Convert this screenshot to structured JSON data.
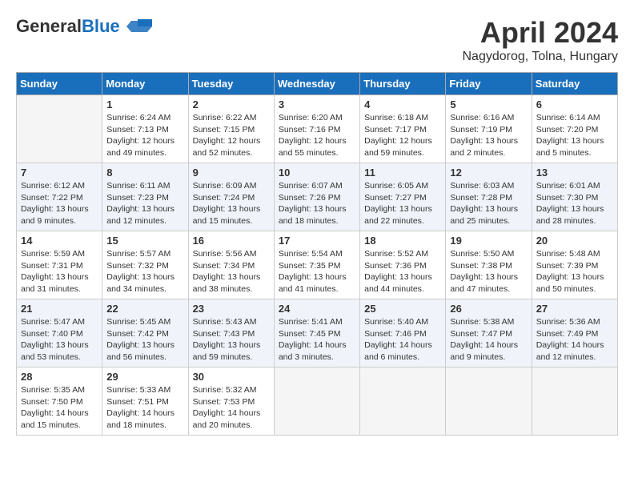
{
  "logo": {
    "line1": "General",
    "line2": "Blue"
  },
  "title": "April 2024",
  "subtitle": "Nagydorog, Tolna, Hungary",
  "weekdays": [
    "Sunday",
    "Monday",
    "Tuesday",
    "Wednesday",
    "Thursday",
    "Friday",
    "Saturday"
  ],
  "weeks": [
    [
      {
        "day": "",
        "info": ""
      },
      {
        "day": "1",
        "info": "Sunrise: 6:24 AM\nSunset: 7:13 PM\nDaylight: 12 hours\nand 49 minutes."
      },
      {
        "day": "2",
        "info": "Sunrise: 6:22 AM\nSunset: 7:15 PM\nDaylight: 12 hours\nand 52 minutes."
      },
      {
        "day": "3",
        "info": "Sunrise: 6:20 AM\nSunset: 7:16 PM\nDaylight: 12 hours\nand 55 minutes."
      },
      {
        "day": "4",
        "info": "Sunrise: 6:18 AM\nSunset: 7:17 PM\nDaylight: 12 hours\nand 59 minutes."
      },
      {
        "day": "5",
        "info": "Sunrise: 6:16 AM\nSunset: 7:19 PM\nDaylight: 13 hours\nand 2 minutes."
      },
      {
        "day": "6",
        "info": "Sunrise: 6:14 AM\nSunset: 7:20 PM\nDaylight: 13 hours\nand 5 minutes."
      }
    ],
    [
      {
        "day": "7",
        "info": "Sunrise: 6:12 AM\nSunset: 7:22 PM\nDaylight: 13 hours\nand 9 minutes."
      },
      {
        "day": "8",
        "info": "Sunrise: 6:11 AM\nSunset: 7:23 PM\nDaylight: 13 hours\nand 12 minutes."
      },
      {
        "day": "9",
        "info": "Sunrise: 6:09 AM\nSunset: 7:24 PM\nDaylight: 13 hours\nand 15 minutes."
      },
      {
        "day": "10",
        "info": "Sunrise: 6:07 AM\nSunset: 7:26 PM\nDaylight: 13 hours\nand 18 minutes."
      },
      {
        "day": "11",
        "info": "Sunrise: 6:05 AM\nSunset: 7:27 PM\nDaylight: 13 hours\nand 22 minutes."
      },
      {
        "day": "12",
        "info": "Sunrise: 6:03 AM\nSunset: 7:28 PM\nDaylight: 13 hours\nand 25 minutes."
      },
      {
        "day": "13",
        "info": "Sunrise: 6:01 AM\nSunset: 7:30 PM\nDaylight: 13 hours\nand 28 minutes."
      }
    ],
    [
      {
        "day": "14",
        "info": "Sunrise: 5:59 AM\nSunset: 7:31 PM\nDaylight: 13 hours\nand 31 minutes."
      },
      {
        "day": "15",
        "info": "Sunrise: 5:57 AM\nSunset: 7:32 PM\nDaylight: 13 hours\nand 34 minutes."
      },
      {
        "day": "16",
        "info": "Sunrise: 5:56 AM\nSunset: 7:34 PM\nDaylight: 13 hours\nand 38 minutes."
      },
      {
        "day": "17",
        "info": "Sunrise: 5:54 AM\nSunset: 7:35 PM\nDaylight: 13 hours\nand 41 minutes."
      },
      {
        "day": "18",
        "info": "Sunrise: 5:52 AM\nSunset: 7:36 PM\nDaylight: 13 hours\nand 44 minutes."
      },
      {
        "day": "19",
        "info": "Sunrise: 5:50 AM\nSunset: 7:38 PM\nDaylight: 13 hours\nand 47 minutes."
      },
      {
        "day": "20",
        "info": "Sunrise: 5:48 AM\nSunset: 7:39 PM\nDaylight: 13 hours\nand 50 minutes."
      }
    ],
    [
      {
        "day": "21",
        "info": "Sunrise: 5:47 AM\nSunset: 7:40 PM\nDaylight: 13 hours\nand 53 minutes."
      },
      {
        "day": "22",
        "info": "Sunrise: 5:45 AM\nSunset: 7:42 PM\nDaylight: 13 hours\nand 56 minutes."
      },
      {
        "day": "23",
        "info": "Sunrise: 5:43 AM\nSunset: 7:43 PM\nDaylight: 13 hours\nand 59 minutes."
      },
      {
        "day": "24",
        "info": "Sunrise: 5:41 AM\nSunset: 7:45 PM\nDaylight: 14 hours\nand 3 minutes."
      },
      {
        "day": "25",
        "info": "Sunrise: 5:40 AM\nSunset: 7:46 PM\nDaylight: 14 hours\nand 6 minutes."
      },
      {
        "day": "26",
        "info": "Sunrise: 5:38 AM\nSunset: 7:47 PM\nDaylight: 14 hours\nand 9 minutes."
      },
      {
        "day": "27",
        "info": "Sunrise: 5:36 AM\nSunset: 7:49 PM\nDaylight: 14 hours\nand 12 minutes."
      }
    ],
    [
      {
        "day": "28",
        "info": "Sunrise: 5:35 AM\nSunset: 7:50 PM\nDaylight: 14 hours\nand 15 minutes."
      },
      {
        "day": "29",
        "info": "Sunrise: 5:33 AM\nSunset: 7:51 PM\nDaylight: 14 hours\nand 18 minutes."
      },
      {
        "day": "30",
        "info": "Sunrise: 5:32 AM\nSunset: 7:53 PM\nDaylight: 14 hours\nand 20 minutes."
      },
      {
        "day": "",
        "info": ""
      },
      {
        "day": "",
        "info": ""
      },
      {
        "day": "",
        "info": ""
      },
      {
        "day": "",
        "info": ""
      }
    ]
  ]
}
